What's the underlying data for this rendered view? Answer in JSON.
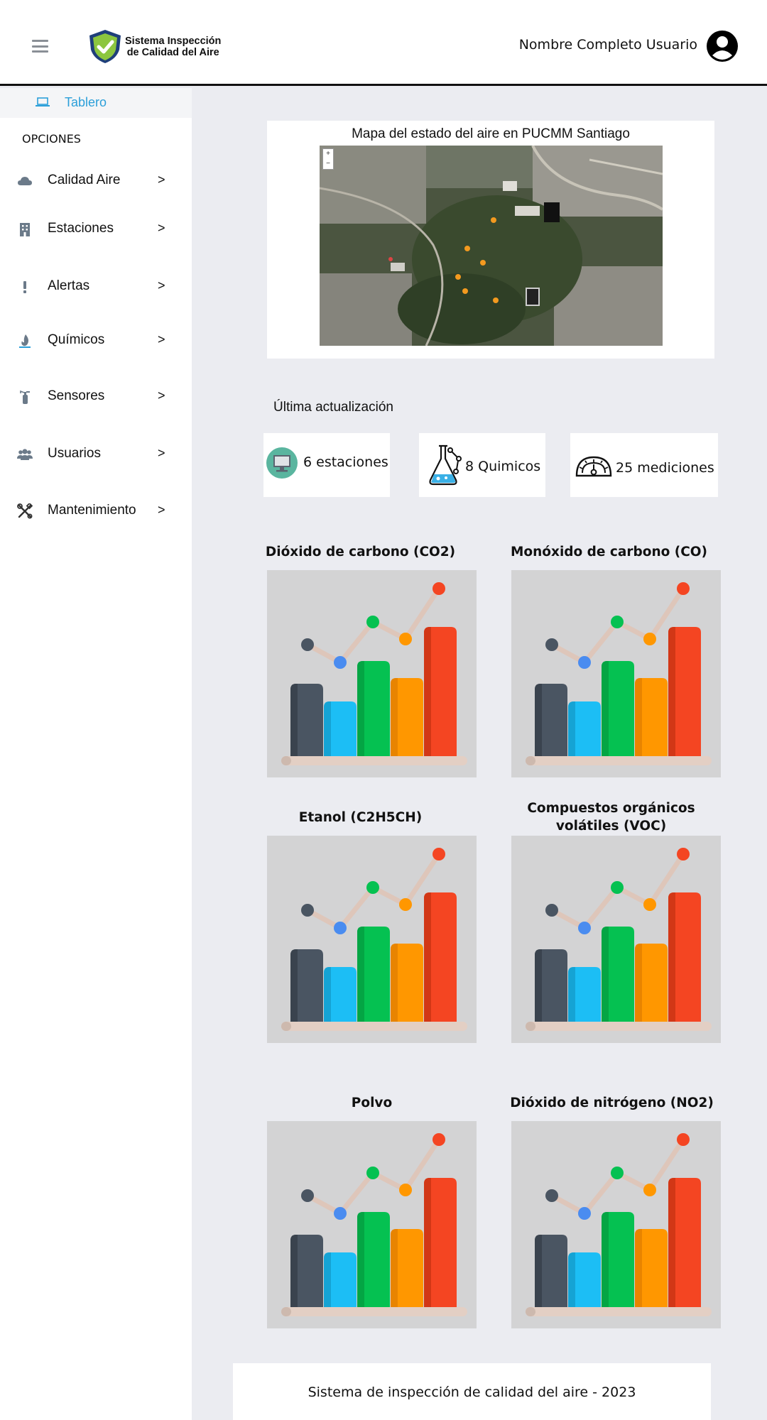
{
  "header": {
    "brand_line1": "Sistema Inspección",
    "brand_line2": "de Calidad del Aire",
    "user_name": "Nombre Completo Usuario"
  },
  "sidebar": {
    "active_item": "Tablero",
    "section_title": "OPCIONES",
    "arrow": ">",
    "items": [
      {
        "label": "Calidad Aire",
        "icon": "cloud-icon"
      },
      {
        "label": "Estaciones",
        "icon": "building-icon"
      },
      {
        "label": "Alertas",
        "icon": "exclamation-icon"
      },
      {
        "label": "Químicos",
        "icon": "flame-icon"
      },
      {
        "label": "Sensores",
        "icon": "extinguisher-icon"
      },
      {
        "label": "Usuarios",
        "icon": "users-icon"
      },
      {
        "label": "Mantenimiento",
        "icon": "tools-icon"
      }
    ]
  },
  "main": {
    "map_title": "Mapa del estado del aire en PUCMM Santiago",
    "map_zoom_in": "+",
    "map_zoom_out": "−",
    "last_update_label": "Última actualización",
    "stats": [
      {
        "text": "6 estaciones",
        "icon": "monitor-icon"
      },
      {
        "text": "8 Quimicos",
        "icon": "flask-icon"
      },
      {
        "text": "25 mediciones",
        "icon": "gauge-icon"
      }
    ],
    "chemicals": [
      {
        "title": "Dióxido de carbono (CO2)"
      },
      {
        "title": "Monóxido de carbono (CO)"
      },
      {
        "title": "Etanol (C2H5CH)"
      },
      {
        "title": "Compuestos orgánicos volátiles (VOC)"
      },
      {
        "title": "Polvo"
      },
      {
        "title": "Dióxido de nitrógeno (NO2)"
      }
    ]
  },
  "footer": {
    "text": "Sistema de inspección de calidad del aire - 2023"
  },
  "colors": {
    "accent": "#2b9fd9",
    "bar_dark": "#4a5562",
    "bar_blue": "#1cbef5",
    "bar_green": "#05c151",
    "bar_orange": "#ff9700",
    "bar_red": "#f44522"
  }
}
